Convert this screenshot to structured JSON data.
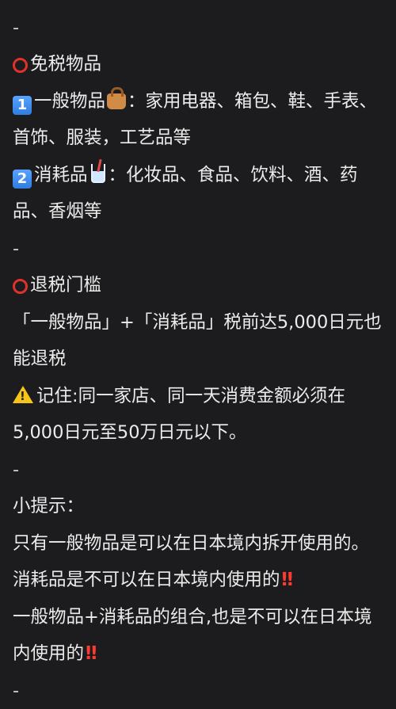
{
  "separator": "-",
  "section1": {
    "title": "免税物品",
    "item1_marker": "1",
    "item1_text_a": "一般物品",
    "item1_text_b": "：家用电器、箱包、鞋、手表、首饰、服装，工艺品等",
    "item2_marker": "2",
    "item2_text_a": "消耗品",
    "item2_text_b": "：化妆品、食品、饮料、酒、药品、香烟等"
  },
  "section2": {
    "title": "退税门槛",
    "line1": "「一般物品」+「消耗品」税前达5,000日元也能退税",
    "warning": "记住:同一家店、同一天消费金额必须在5,000日元至50万日元以下。"
  },
  "tips": {
    "title": "小提示：",
    "p1": "只有一般物品是可以在日本境内拆开使用的。消耗品是不可以在日本境内使用的",
    "p1_mark": "‼",
    "p2": "一般物品+消耗品的组合,也是不可以在日本境内使用的",
    "p2_mark": "‼"
  },
  "icons": {
    "ring": "hollow-red-circle-icon",
    "bag": "handbag-icon",
    "cup": "cup-with-straw-icon",
    "warning": "warning-icon",
    "double_exclamation": "double-exclamation-icon"
  }
}
